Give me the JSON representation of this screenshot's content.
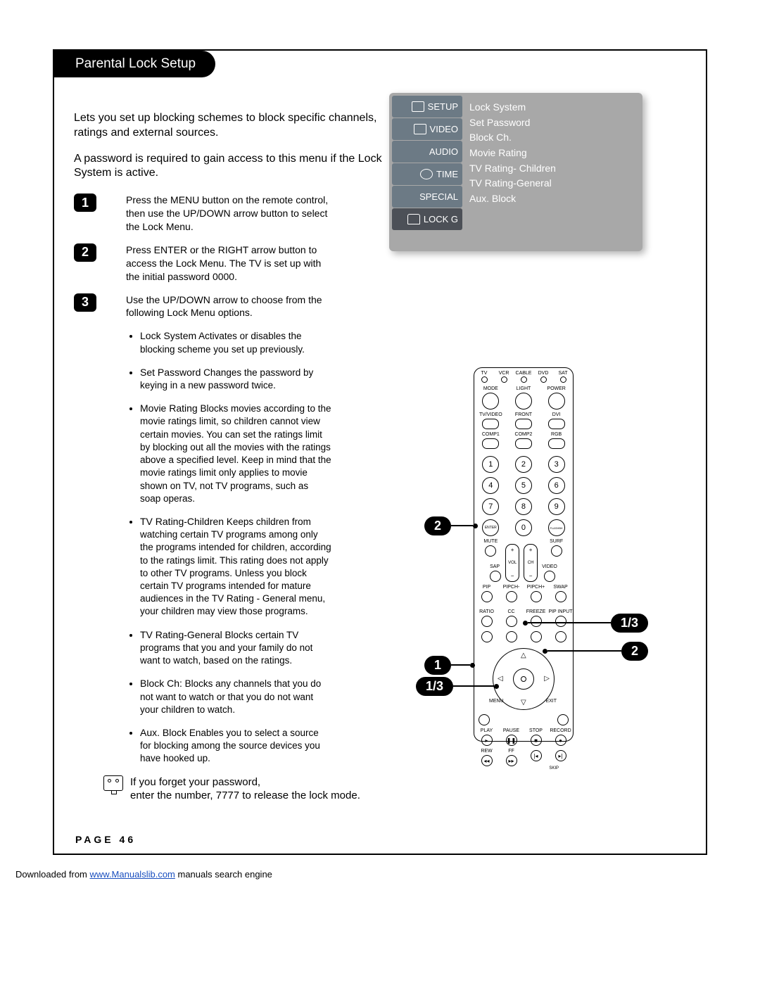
{
  "header": {
    "title": "Parental Lock Setup"
  },
  "intro": {
    "p1": "Lets you set up blocking schemes to block specific channels, ratings and external sources.",
    "p2": "A password is required to gain access to this menu if the Lock System is active."
  },
  "steps": [
    {
      "num": "1",
      "text": "Press the MENU button on the remote control, then use the UP/DOWN arrow button to select the Lock Menu."
    },
    {
      "num": "2",
      "text": "Press ENTER or the RIGHT arrow button to access the Lock Menu. The TV is set up with the initial password 0000."
    },
    {
      "num": "3",
      "text": "Use the UP/DOWN arrow to choose from the following Lock Menu options."
    }
  ],
  "bullets": [
    {
      "title": "Lock System",
      "text": " Activates or disables the blocking scheme you set up previously."
    },
    {
      "title": "Set Password",
      "text": " Changes the password by keying in a new password twice."
    },
    {
      "title": "Movie Rating",
      "text": " Blocks movies according to the movie ratings limit, so children cannot view certain movies. You can set the ratings limit by blocking out all the movies with the ratings above a specified level. Keep in mind that the movie ratings limit only applies to movie shown on TV, not TV programs, such as soap operas."
    },
    {
      "title": "TV Rating-Children",
      "text": " Keeps children from watching certain TV programs among only the programs intended for children, according to the ratings limit. This rating does not apply to other TV programs. Unless you block certain TV programs intended for mature audiences in the TV Rating - General menu, your children may view those programs."
    },
    {
      "title": "TV Rating-General",
      "text": " Blocks certain TV programs that you and your family do not want to watch, based on the ratings."
    },
    {
      "title": "Block Ch:",
      "text": " Blocks any channels that you do not want to  watch or that you do not want your children to watch."
    },
    {
      "title": "Aux. Block",
      "text": " Enables you to select a source for blocking among the source devices you have hooked up."
    }
  ],
  "note": {
    "text": "If you forget your password,\nenter the number, 7777 to release the lock mode."
  },
  "osd": {
    "tabs": [
      "SETUP",
      "VIDEO",
      "AUDIO",
      "TIME",
      "SPECIAL",
      "LOCK G"
    ],
    "items": [
      "Lock System",
      "Set Password",
      "Block Ch.",
      "Movie Rating",
      "TV Rating- Children",
      "TV Rating-General",
      "Aux. Block"
    ]
  },
  "remote": {
    "topRow": [
      "TV",
      "VCR",
      "CABLE",
      "DVD",
      "SAT"
    ],
    "row2": [
      "MODE",
      "LIGHT",
      "POWER"
    ],
    "row3": [
      "TV/VIDEO",
      "FRONT",
      "DVI"
    ],
    "row4": [
      "COMP1",
      "COMP2",
      "RGB"
    ],
    "numpad": [
      "1",
      "2",
      "3",
      "4",
      "5",
      "6",
      "7",
      "8",
      "9",
      "ENTER",
      "0",
      "FLASHBK"
    ],
    "row5": [
      "MUTE",
      "",
      "SURF"
    ],
    "row6": [
      "SAP",
      "",
      "VIDEO"
    ],
    "rockers": {
      "vol": "VOL",
      "ch": "CH"
    },
    "row7": [
      "PIP",
      "PIPCH-",
      "PIPCH+",
      "SWAP"
    ],
    "row8": [
      "RATIO",
      "CC",
      "FREEZE",
      "PIP INPUT"
    ],
    "dpad": {
      "menu": "MENU",
      "exit": "EXIT"
    },
    "row9": [
      "PLAY",
      "PAUSE",
      "STOP",
      "RECORD"
    ],
    "row10": [
      "REW",
      "FF",
      "",
      ""
    ],
    "skip": "SKIP"
  },
  "callouts": {
    "left1": "2",
    "left2": "1",
    "left3": "1/3",
    "right1": "1/3",
    "right2": "2"
  },
  "pageFooter": "PAGE 46",
  "download": {
    "prefix": "Downloaded from ",
    "link_text": "www.Manualslib.com",
    "suffix": " manuals search engine"
  }
}
